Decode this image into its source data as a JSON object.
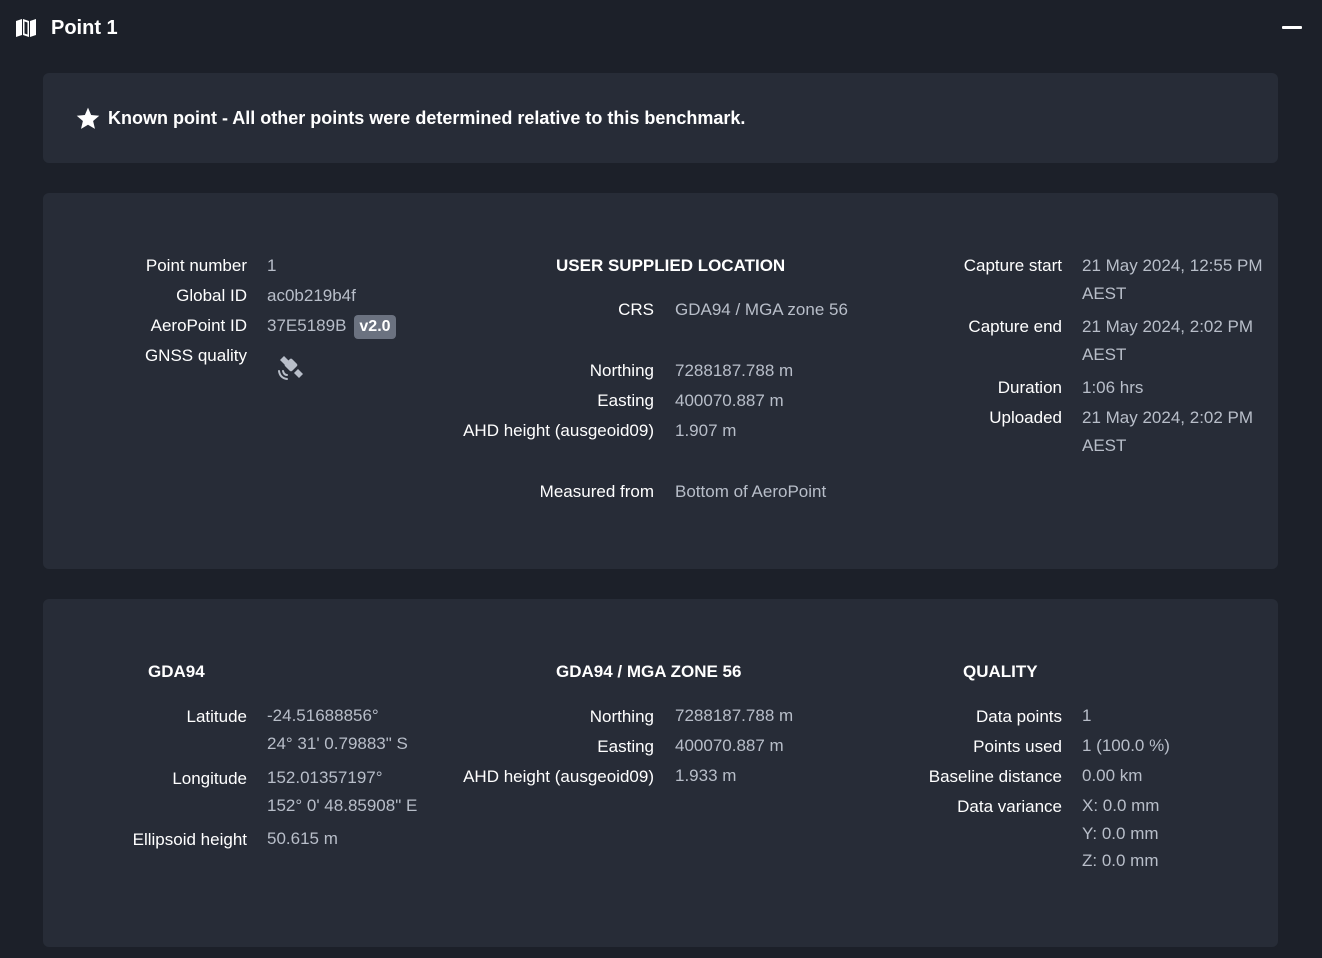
{
  "header": {
    "title": "Point 1"
  },
  "banner": {
    "text": "Known point - All other points were determined relative to this benchmark."
  },
  "point_info": {
    "point_number_label": "Point number",
    "point_number": "1",
    "global_id_label": "Global ID",
    "global_id": "ac0b219b4f",
    "aeropoint_id_label": "AeroPoint ID",
    "aeropoint_id": "37E5189B",
    "version_badge": "v2.0",
    "gnss_quality_label": "GNSS quality"
  },
  "user_location": {
    "heading": "USER SUPPLIED LOCATION",
    "crs_label": "CRS",
    "crs": "GDA94 / MGA zone 56",
    "northing_label": "Northing",
    "northing": "7288187.788 m",
    "easting_label": "Easting",
    "easting": "400070.887 m",
    "ahd_label": "AHD height (ausgeoid09)",
    "ahd": "1.907 m",
    "measured_from_label": "Measured from",
    "measured_from": "Bottom of AeroPoint"
  },
  "capture": {
    "start_label": "Capture start",
    "start": "21 May 2024, 12:55 PM AEST",
    "end_label": "Capture end",
    "end": "21 May 2024, 2:02 PM AEST",
    "duration_label": "Duration",
    "duration": "1:06 hrs",
    "uploaded_label": "Uploaded",
    "uploaded": "21 May 2024, 2:02 PM AEST"
  },
  "gda94": {
    "heading": "GDA94",
    "latitude_label": "Latitude",
    "latitude_dec": "-24.51688856°",
    "latitude_dms": "24° 31' 0.79883\" S",
    "longitude_label": "Longitude",
    "longitude_dec": "152.01357197°",
    "longitude_dms": "152° 0' 48.85908\" E",
    "ellipsoid_label": "Ellipsoid height",
    "ellipsoid": "50.615 m"
  },
  "mga": {
    "heading": "GDA94 / MGA ZONE 56",
    "northing_label": "Northing",
    "northing": "7288187.788 m",
    "easting_label": "Easting",
    "easting": "400070.887 m",
    "ahd_label": "AHD height (ausgeoid09)",
    "ahd": "1.933 m"
  },
  "quality": {
    "heading": "QUALITY",
    "data_points_label": "Data points",
    "data_points": "1",
    "points_used_label": "Points used",
    "points_used": "1 (100.0 %)",
    "baseline_label": "Baseline distance",
    "baseline": "0.00 km",
    "variance_label": "Data variance",
    "variance_x": "X: 0.0 mm",
    "variance_y": "Y: 0.0 mm",
    "variance_z": "Z: 0.0 mm"
  }
}
